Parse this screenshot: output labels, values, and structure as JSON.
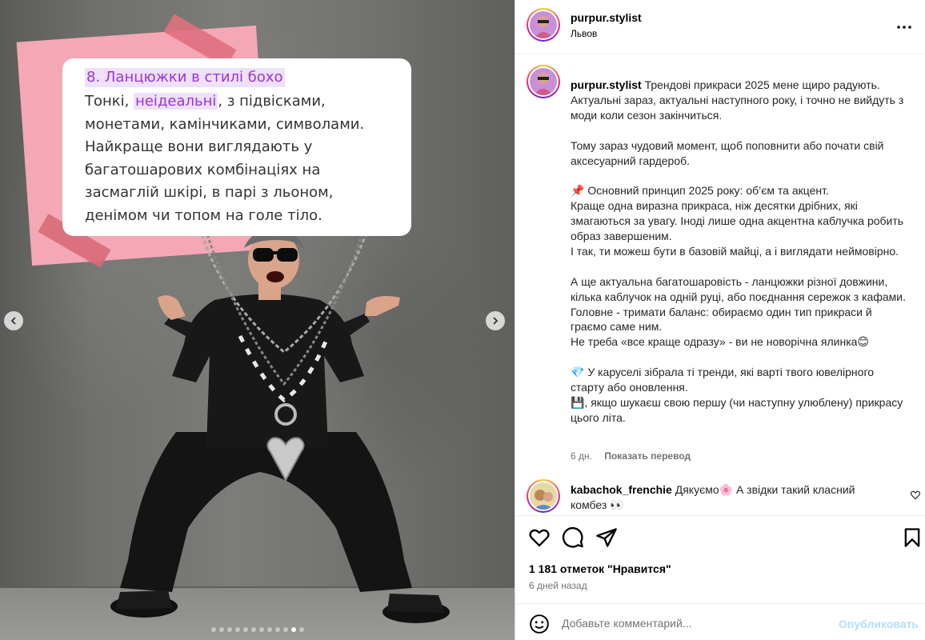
{
  "slide_card": {
    "title": "8. Ланцюжки в стилі бохо",
    "body_pre": "Тонкі, ",
    "body_highlight": "неідеальні",
    "body_post": ", з підвісками, монетами, камінчиками, символами. Найкраще вони виглядають у багатошарових комбінаціях на засмаглій шкірі, в парі з льоном, денімом чи топом на голе тіло."
  },
  "carousel": {
    "total": 12,
    "active_index": 10
  },
  "header": {
    "username": "purpur.stylist",
    "location": "Львов"
  },
  "caption": {
    "username": "purpur.stylist",
    "lines": [
      "Трендові прикраси 2025 мене щиро радують. Актуальні зараз, актуальні наступного року, і точно не вийдуть з моди коли сезон закінчиться.",
      "",
      "Тому зараз чудовий момент, щоб поповнити або почати свій аксесуарний гардероб.",
      "",
      "📌 Основний принцип 2025 року: об’єм та акцент.",
      "Краще одна виразна прикраса, ніж десятки дрібних, які змагаються за увагу. Іноді лише одна акцентна каблучка робить образ завершеним.",
      "І так, ти можеш бути в базовій майці, а і виглядати неймовірно.",
      "",
      "А ще актуальна багатошаровість - ланцюжки різної довжини, кілька каблучок на одній руці, або поєднання сережок з кафами.",
      "Головне - тримати баланс: обираємо один тип прикраси й граємо саме ним.",
      "Не треба «все краще одразу» - ви не новорічна ялинка😊",
      "",
      "💎 У каруселі зібрала ті тренди, які варті твого ювелірного старту або оновлення.",
      "💾, якщо шукаєш свою першу (чи наступну улюблену) прикрасу цього літа."
    ],
    "age": "6 дн.",
    "translate": "Показать перевод"
  },
  "comment": {
    "username": "kabachok_frenchie",
    "text": "Дякуємо🌸 А звідки такий класний комбез 👀"
  },
  "actions": {
    "likes": "1 181 отметок \"Нравится\"",
    "time_ago": "6 дней назад"
  },
  "add_comment": {
    "placeholder": "Добавьте комментарий...",
    "post_label": "Опубликовать"
  },
  "colors": {
    "accent_purple": "#9b35d6",
    "highlight": "#efe0fb",
    "pink_note": "#f4a7b4",
    "post_disabled": "#b2dffc"
  }
}
